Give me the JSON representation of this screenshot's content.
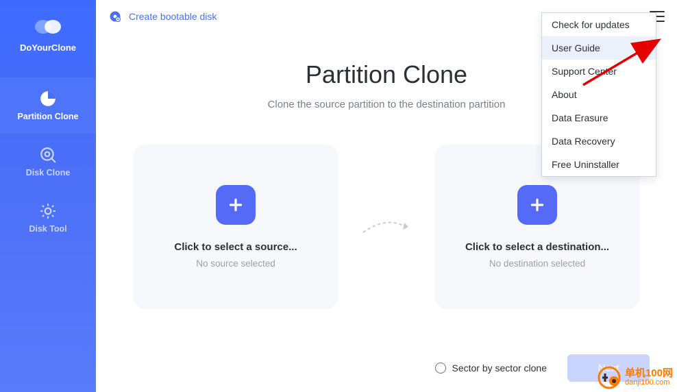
{
  "app_name": "DoYourClone",
  "topbar": {
    "create_bootable": "Create bootable disk"
  },
  "sidebar": {
    "items": [
      {
        "label": "Partition Clone",
        "icon": "pie-icon"
      },
      {
        "label": "Disk Clone",
        "icon": "search-icon"
      },
      {
        "label": "Disk Tool",
        "icon": "gear-icon"
      }
    ]
  },
  "page": {
    "title": "Partition Clone",
    "subtitle": "Clone the source partition to the destination partition"
  },
  "source_card": {
    "title": "Click to select a source...",
    "sub": "No source selected"
  },
  "dest_card": {
    "title": "Click to select a destination...",
    "sub": "No destination selected"
  },
  "bottom": {
    "sector_label": "Sector by sector clone",
    "next": "Next"
  },
  "menu": {
    "items": [
      "Check for updates",
      "User Guide",
      "Support Center",
      "About",
      "Data Erasure",
      "Data Recovery",
      "Free Uninstaller"
    ],
    "hovered_index": 1
  },
  "watermark": {
    "line1": "单机100网",
    "line2": "danji100.com"
  }
}
